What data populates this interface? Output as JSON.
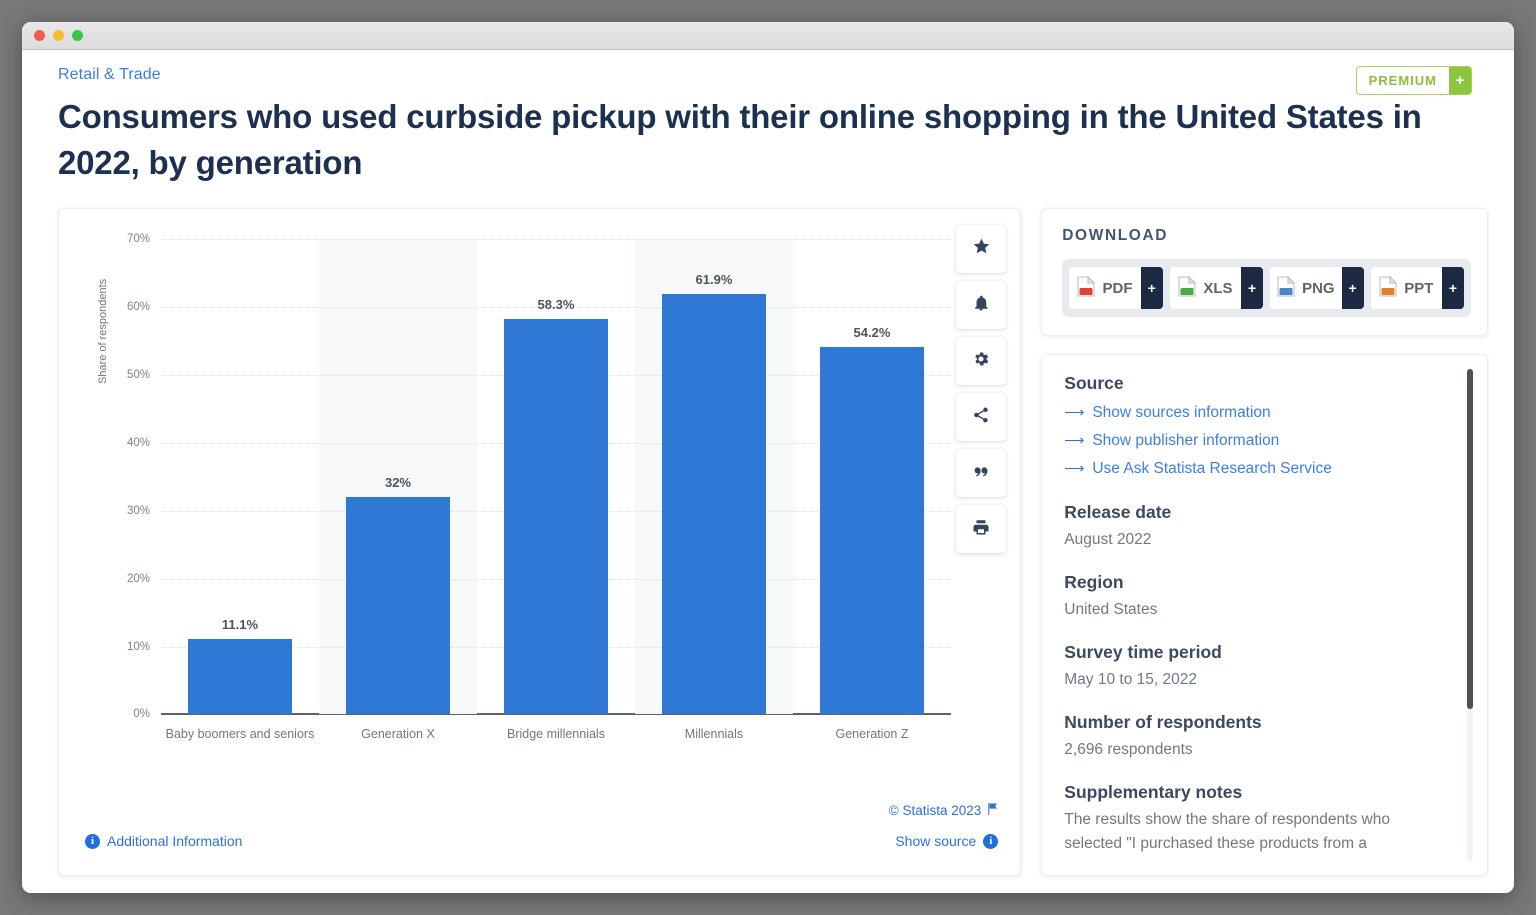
{
  "window": {
    "traffic_lights": [
      "close",
      "minimize",
      "maximize"
    ]
  },
  "header": {
    "breadcrumb": "Retail & Trade",
    "title": "Consumers who used curbside pickup with their online shopping in the United States in 2022, by generation",
    "premium_label": "PREMIUM",
    "premium_plus": "+"
  },
  "chart_data": {
    "type": "bar",
    "title": "Consumers who used curbside pickup with their online shopping in the United States in 2022, by generation",
    "xlabel": "",
    "ylabel": "Share of respondents",
    "categories": [
      "Baby boomers and seniors",
      "Generation X",
      "Bridge millennials",
      "Millennials",
      "Generation Z"
    ],
    "values": [
      11.1,
      32,
      58.3,
      61.9,
      54.2
    ],
    "value_labels": [
      "11.1%",
      "32%",
      "58.3%",
      "61.9%",
      "54.2%"
    ],
    "ylim": [
      0,
      70
    ],
    "yticks": [
      0,
      10,
      20,
      30,
      40,
      50,
      60,
      70
    ],
    "ytick_labels": [
      "0%",
      "10%",
      "20%",
      "30%",
      "40%",
      "50%",
      "60%",
      "70%"
    ],
    "grid": true,
    "legend": "none",
    "bar_color": "#2f78d4",
    "band_color": "#f7f8f9"
  },
  "toolbar": {
    "items": [
      {
        "name": "favorite",
        "icon": "star-icon"
      },
      {
        "name": "alert",
        "icon": "bell-icon"
      },
      {
        "name": "settings",
        "icon": "gear-icon"
      },
      {
        "name": "share",
        "icon": "share-icon"
      },
      {
        "name": "cite",
        "icon": "quote-icon"
      },
      {
        "name": "print",
        "icon": "printer-icon"
      }
    ]
  },
  "chart_footer": {
    "copyright": "© Statista 2023",
    "additional_information": "Additional Information",
    "show_source": "Show source"
  },
  "download": {
    "heading": "DOWNLOAD",
    "buttons": [
      {
        "label": "PDF",
        "plus": "+",
        "icon": "pdf-file-icon",
        "color": "#d94436"
      },
      {
        "label": "XLS",
        "plus": "+",
        "icon": "xls-file-icon",
        "color": "#49a942"
      },
      {
        "label": "PNG",
        "plus": "+",
        "icon": "png-file-icon",
        "color": "#4a86c8"
      },
      {
        "label": "PPT",
        "plus": "+",
        "icon": "ppt-file-icon",
        "color": "#e1822a"
      }
    ]
  },
  "source_panel": {
    "source_heading": "Source",
    "links": [
      "Show sources information",
      "Show publisher information",
      "Use Ask Statista Research Service"
    ],
    "release_date_heading": "Release date",
    "release_date": "August 2022",
    "region_heading": "Region",
    "region": "United States",
    "survey_period_heading": "Survey time period",
    "survey_period": "May 10 to 15, 2022",
    "respondents_heading": "Number of respondents",
    "respondents": "2,696 respondents",
    "notes_heading": "Supplementary notes",
    "notes": "The results show the share of respondents who selected \"I purchased these products from a"
  }
}
